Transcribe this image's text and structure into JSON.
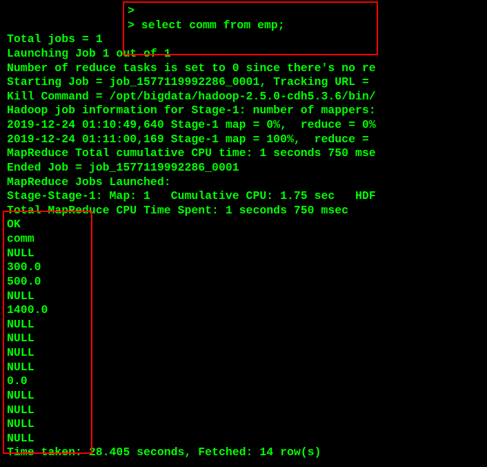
{
  "terminal": {
    "prompt1": ">",
    "prompt2": "> select comm from emp;",
    "lines": [
      "Total jobs = 1",
      "Launching Job 1 out of 1",
      "Number of reduce tasks is set to 0 since there's no re",
      "Starting Job = job_1577119992286_0001, Tracking URL = ",
      "Kill Command = /opt/bigdata/hadoop-2.5.0-cdh5.3.6/bin/",
      "Hadoop job information for Stage-1: number of mappers:",
      "2019-12-24 01:10:49,640 Stage-1 map = 0%,  reduce = 0%",
      "2019-12-24 01:11:00,169 Stage-1 map = 100%,  reduce = ",
      "MapReduce Total cumulative CPU time: 1 seconds 750 mse",
      "Ended Job = job_1577119992286_0001",
      "MapReduce Jobs Launched:",
      "Stage-Stage-1: Map: 1   Cumulative CPU: 1.75 sec   HDF",
      "Total MapReduce CPU Time Spent: 1 seconds 750 msec",
      "OK",
      "comm",
      "NULL",
      "300.0",
      "500.0",
      "NULL",
      "1400.0",
      "NULL",
      "NULL",
      "NULL",
      "NULL",
      "0.0",
      "NULL",
      "NULL",
      "NULL",
      "NULL",
      "Time taken: 28.405 seconds, Fetched: 14 row(s)"
    ]
  }
}
